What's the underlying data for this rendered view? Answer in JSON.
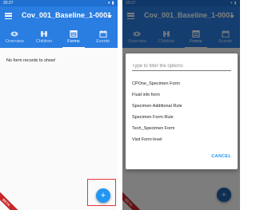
{
  "left_screen": {
    "status_time": "20:27",
    "status_icons": "▾ ▮",
    "app_title": "Cov_001_Baseline_1-0001",
    "tabs": [
      {
        "label": "Overview",
        "icon": "eye-icon",
        "active": false
      },
      {
        "label": "Children",
        "icon": "children-icon",
        "active": false
      },
      {
        "label": "Forms",
        "icon": "forms-icon",
        "active": true
      },
      {
        "label": "Events",
        "icon": "events-icon",
        "active": false
      }
    ],
    "empty_message": "No form records to show!",
    "fab_label": "+",
    "beta_label": "BETA"
  },
  "right_screen": {
    "status_time": "20:27",
    "status_icons": "▾ ▮",
    "app_title": "Cov_001_Baseline_1-0001",
    "tabs": [
      {
        "label": "Overview",
        "icon": "eye-icon",
        "active": false
      },
      {
        "label": "Children",
        "icon": "children-icon",
        "active": false
      },
      {
        "label": "Forms",
        "icon": "forms-icon",
        "active": true
      },
      {
        "label": "Events",
        "icon": "events-icon",
        "active": false
      }
    ],
    "fab_label": "+",
    "beta_label": "BETA",
    "dialog": {
      "filter_placeholder": "Type to filter the options",
      "options": [
        "CPOne_Specimen Form",
        "Fluid info form",
        "Specimen Additional Rule",
        "Specimen Form Rule",
        "Tech_Specimen Form",
        "Visit Form level"
      ],
      "cancel_label": "CANCEL"
    }
  },
  "colors": {
    "appbar": "#2a7de1",
    "statusbar": "#1e6fd0",
    "fab": "#2196f3",
    "highlight": "#e53935",
    "beta": "#c62828",
    "cancel": "#2196f3"
  }
}
